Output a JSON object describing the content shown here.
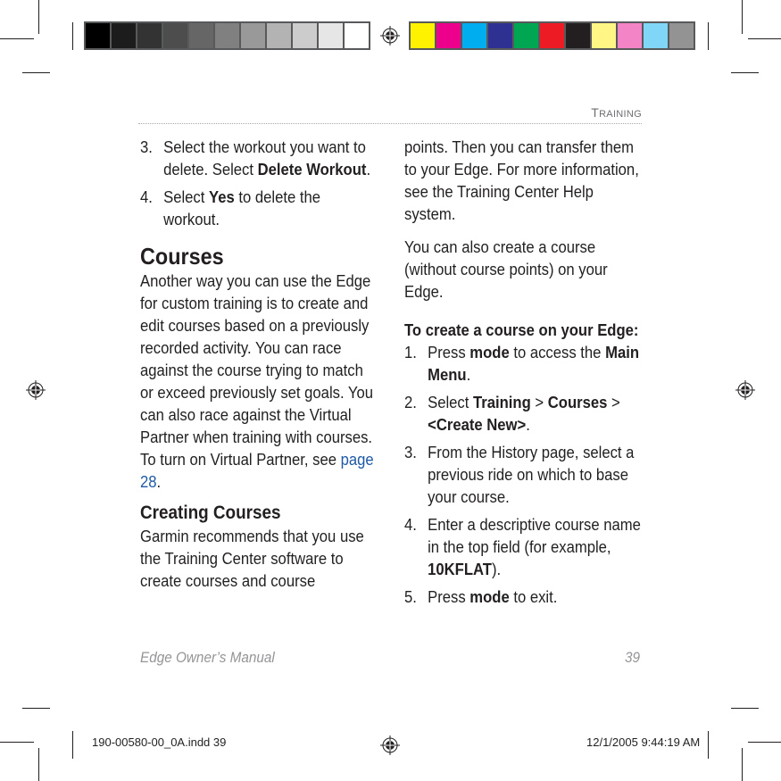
{
  "printer_marks": {
    "grayscale_swatches": [
      "#000000",
      "#1c1c1c",
      "#333333",
      "#4d4d4d",
      "#666666",
      "#808080",
      "#999999",
      "#b3b3b3",
      "#cccccc",
      "#e6e6e6",
      "#ffffff"
    ],
    "color_swatches": [
      "#fff200",
      "#ec008c",
      "#00aeef",
      "#2e3192",
      "#00a651",
      "#ed1c24",
      "#231f20",
      "#fff685",
      "#f384c5",
      "#7fd6f7",
      "#939393"
    ]
  },
  "header": {
    "section_title_first": "T",
    "section_title_rest": "RAINING"
  },
  "left_column": {
    "steps": [
      {
        "num": "3.",
        "parts": [
          "Select the workout you want to delete. Select ",
          "Delete Workout",
          "."
        ]
      },
      {
        "num": "4.",
        "parts": [
          "Select ",
          "Yes",
          " to delete the workout."
        ]
      }
    ],
    "courses_heading": "Courses",
    "courses_body_1": "Another way you can use the Edge for custom training is to create and edit courses based on a previously recorded activity. You can race against the course trying to match or exceed previously set goals. You can also race against the Virtual Partner when training with courses. To turn on Virtual Partner, see ",
    "courses_link": "page 28",
    "courses_body_end": ".",
    "creating_heading": "Creating Courses",
    "creating_body": "Garmin recommends that you use the Training Center software to create courses and course"
  },
  "right_column": {
    "para1": "points. Then you can transfer them to your Edge. For more information, see the Training Center Help system.",
    "para2": "You can also create a course (without course points) on your Edge.",
    "procedure_heading": "To create a course on your Edge:",
    "steps": [
      {
        "num": "1.",
        "a": "Press ",
        "b": "mode",
        "c": " to access the ",
        "d": "Main Menu",
        "e": "."
      },
      {
        "num": "2.",
        "a": "Select ",
        "b": "Training",
        "c": " > ",
        "d": "Courses",
        "e": " >",
        "f": "<Create New>",
        "g": "."
      },
      {
        "num": "3.",
        "a": "From the History page, select a previous ride on which to base your course."
      },
      {
        "num": "4.",
        "a": "Enter a descriptive course name in the top field (for example, ",
        "b": "10KFLAT",
        "c": ")."
      },
      {
        "num": "5.",
        "a": "Press ",
        "b": "mode",
        "c": " to exit."
      }
    ]
  },
  "footer": {
    "manual_title": "Edge Owner’s Manual",
    "page_number": "39"
  },
  "slug": {
    "file": "190-00580-00_0A.indd   39",
    "timestamp": "12/1/2005   9:44:19 AM"
  }
}
